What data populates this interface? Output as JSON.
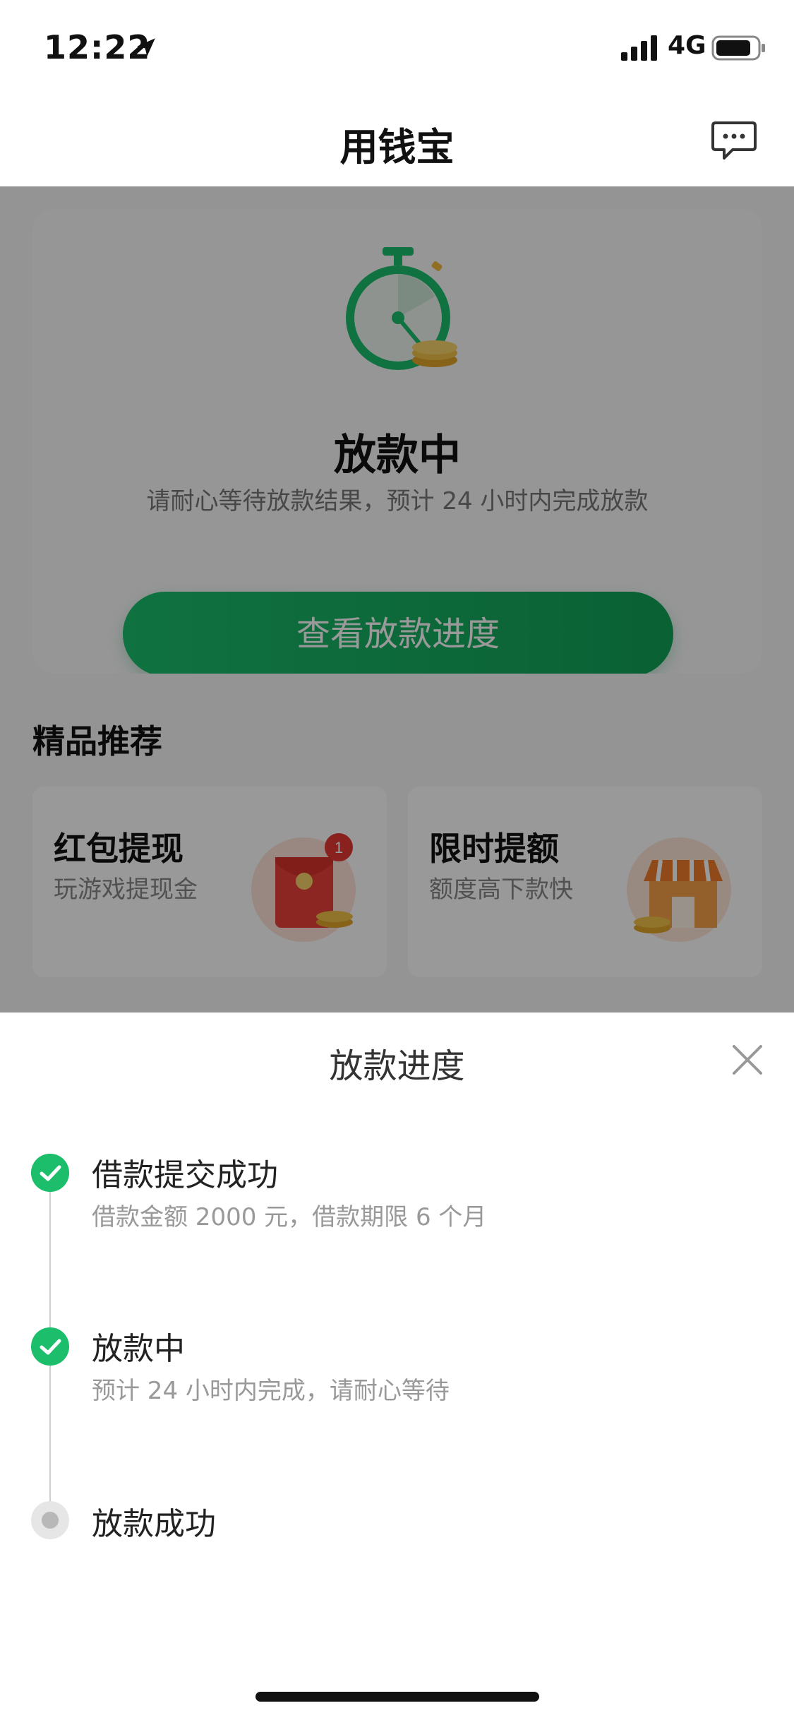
{
  "status_bar": {
    "time": "12:22",
    "network": "4G"
  },
  "nav": {
    "title": "用钱宝",
    "message_icon": "chat-bubble-icon"
  },
  "status_card": {
    "title": "放款中",
    "description": "请耐心等待放款结果，预计 24 小时内完成放款",
    "button_label": "查看放款进度"
  },
  "recommend": {
    "section_title": "精品推荐",
    "items": [
      {
        "title": "红包提现",
        "subtitle": "玩游戏提现金",
        "badge": "1"
      },
      {
        "title": "限时提额",
        "subtitle": "额度高下款快"
      }
    ]
  },
  "sheet": {
    "title": "放款进度",
    "steps": [
      {
        "title": "借款提交成功",
        "desc": "借款金额 2000 元，借款期限 6 个月",
        "state": "done"
      },
      {
        "title": "放款中",
        "desc": "预计 24 小时内完成，请耐心等待",
        "state": "done"
      },
      {
        "title": "放款成功",
        "desc": "",
        "state": "pending"
      }
    ]
  },
  "colors": {
    "accent": "#1cbe6c",
    "accent_dark": "#11a257",
    "badge": "#e53935"
  }
}
